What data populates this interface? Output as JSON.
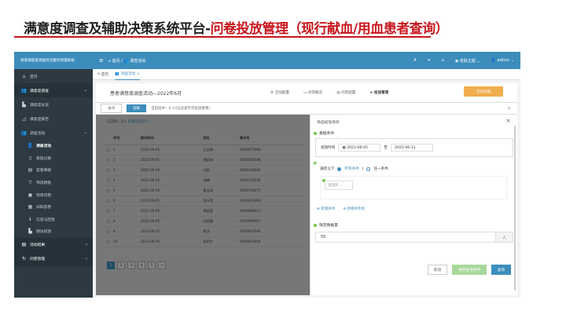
{
  "slide": {
    "title_main": "满意度调查及辅助决策系统平台-",
    "title_accent": "问卷投放管理（现行献血/用血患者查询）"
  },
  "header": {
    "brand": "患者满意度调查综合服务管理系统",
    "menu_icon": "hamburger-icon",
    "breadcrumb_home": "首页",
    "breadcrumb_current": "调查活动",
    "font_a": "A",
    "fullscreen": "✕",
    "home": "⌂",
    "theme": "皮肤主题",
    "user": "admin"
  },
  "sidebar": {
    "home": "首页",
    "group1": "满意度调查",
    "items1": [
      {
        "label": "满意度总览",
        "icon": "chart-icon"
      },
      {
        "label": "满意度报告",
        "icon": "graph-icon"
      },
      {
        "label": "调查活动",
        "icon": "users-icon"
      }
    ],
    "sub": [
      {
        "label": "调查活动",
        "icon": "user-icon"
      },
      {
        "label": "投放记录",
        "icon": "bookmark-icon"
      },
      {
        "label": "答卷审核",
        "icon": "print-icon"
      },
      {
        "label": "筛选模板",
        "icon": "filter-icon"
      },
      {
        "label": "现场问卷",
        "icon": "doc-icon"
      },
      {
        "label": "扫码答卷",
        "icon": "grid-icon"
      },
      {
        "label": "信息与回复",
        "icon": "info-icon"
      },
      {
        "label": "随访投放",
        "icon": "chart-icon"
      }
    ],
    "group2": "活动结果",
    "group3": "问卷管理"
  },
  "tabs": [
    {
      "label": "首页"
    },
    {
      "label": "调查活动"
    }
  ],
  "activity": {
    "title": "患者满意度调查活动—2022年6月",
    "nav": [
      "活动配置",
      "问卷概况",
      "问卷配置",
      "投放管理"
    ],
    "button": "活动列表"
  },
  "filter": {
    "close": "关闭",
    "select": "选择",
    "note": "当前选中：0  人(已过滤不可投放患者)"
  },
  "table": {
    "selected_prefix": "已选择：0人",
    "selected_link": "批量选定的人",
    "headers": [
      "序号",
      "就诊时间",
      "姓名",
      "就诊号"
    ],
    "rows": [
      [
        "1",
        "2022-06-05",
        "王金辉",
        "0000027906"
      ],
      [
        "2",
        "2022-06-05",
        "黄园海",
        "0000048188"
      ],
      [
        "3",
        "2022-06-05",
        "刘某",
        "0000104846"
      ],
      [
        "4",
        "2022-06-05",
        "何峰",
        "0016716058"
      ],
      [
        "5",
        "2022-06-05",
        "曹玉和",
        "0016750077"
      ],
      [
        "6",
        "2022-06-05",
        "范叶宽",
        "0016031069"
      ],
      [
        "7",
        "2022-06-05",
        "周国宽",
        "0000098011"
      ],
      [
        "8",
        "2022-06-05",
        "刘龙圆",
        "0016999007"
      ],
      [
        "9",
        "2022-06-05",
        "蔡冰",
        "0016947094"
      ],
      [
        "10",
        "2022-06-05",
        "张明中",
        "0000002004"
      ]
    ],
    "pages": [
      "1",
      "2",
      "3",
      "4",
      "5",
      ">"
    ]
  },
  "modal": {
    "title": "筛选投放目标",
    "basic": "基础条件",
    "time_label": "投放时间",
    "date_from": "2022-06-05",
    "date_sep": "至",
    "date_to": "2022-06-11",
    "match_label": "满足以下",
    "opt_all": "所有条件",
    "opt_any": "任一条件",
    "select_ph": "请选择",
    "link1": "新增条件",
    "link2": "新增条件组",
    "limit_label": "限定数据量",
    "limit_value": "50",
    "unit": "人",
    "cancel": "取消",
    "save": "保存查询条件",
    "query": "查询"
  }
}
